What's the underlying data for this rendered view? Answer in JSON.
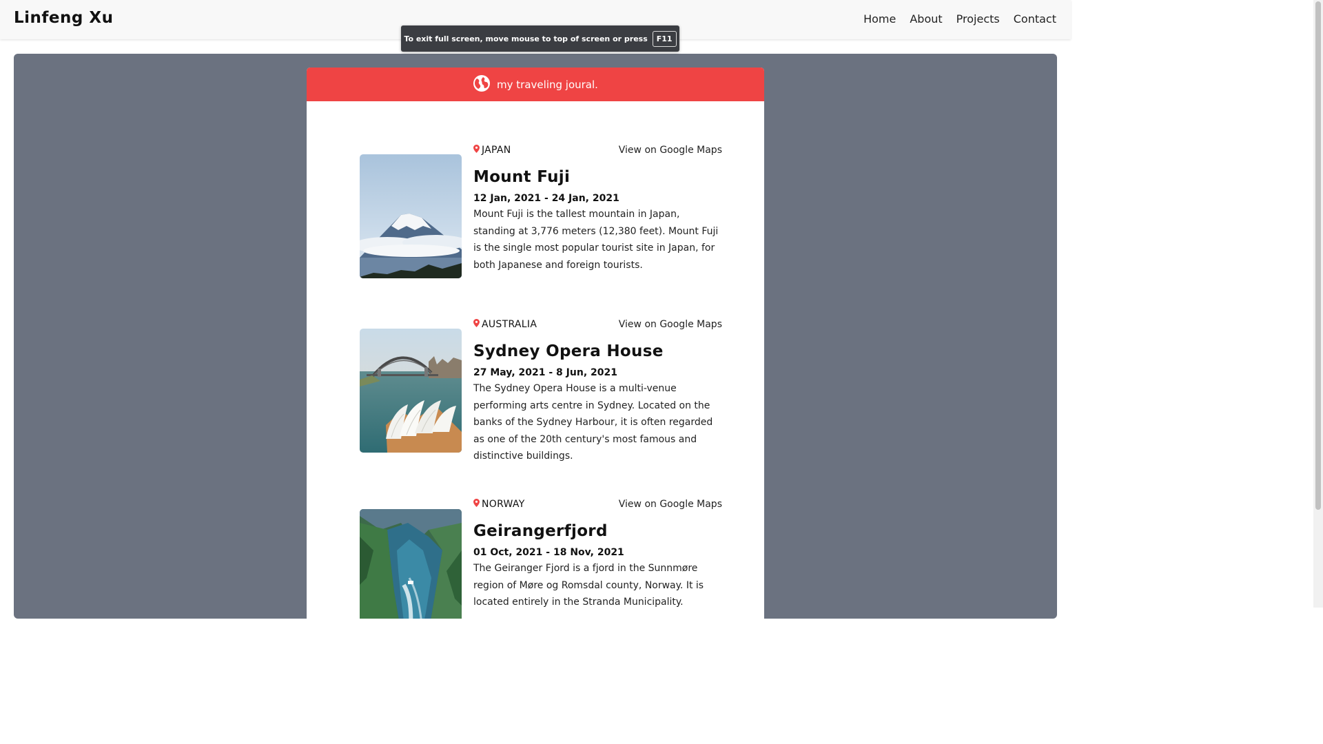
{
  "header": {
    "brand": "Linfeng Xu",
    "nav": [
      "Home",
      "About",
      "Projects",
      "Contact"
    ]
  },
  "fullscreen_notice": {
    "text": "To exit full screen, move mouse to top of screen or press",
    "key": "F11"
  },
  "journal": {
    "title": "my traveling joural.",
    "icon": "globe-icon",
    "accent_color": "#ef4444",
    "entries": [
      {
        "country": "JAPAN",
        "maps_link": "View on Google Maps",
        "title": "Mount Fuji",
        "dates": "12 Jan, 2021 - 24 Jan, 2021",
        "description": "Mount Fuji is the tallest mountain in Japan, standing at 3,776 meters (12,380 feet). Mount Fuji is the single most popular tourist site in Japan, for both Japanese and foreign tourists."
      },
      {
        "country": "AUSTRALIA",
        "maps_link": "View on Google Maps",
        "title": "Sydney Opera House",
        "dates": "27 May, 2021 - 8 Jun, 2021",
        "description": "The Sydney Opera House is a multi-venue performing arts centre in Sydney. Located on the banks of the Sydney Harbour, it is often regarded as one of the 20th century's most famous and distinctive buildings."
      },
      {
        "country": "NORWAY",
        "maps_link": "View on Google Maps",
        "title": "Geirangerfjord",
        "dates": "01 Oct, 2021 - 18 Nov, 2021",
        "description": "The Geiranger Fjord is a fjord in the Sunnmøre region of Møre og Romsdal county, Norway. It is located entirely in the Stranda Municipality."
      }
    ]
  }
}
